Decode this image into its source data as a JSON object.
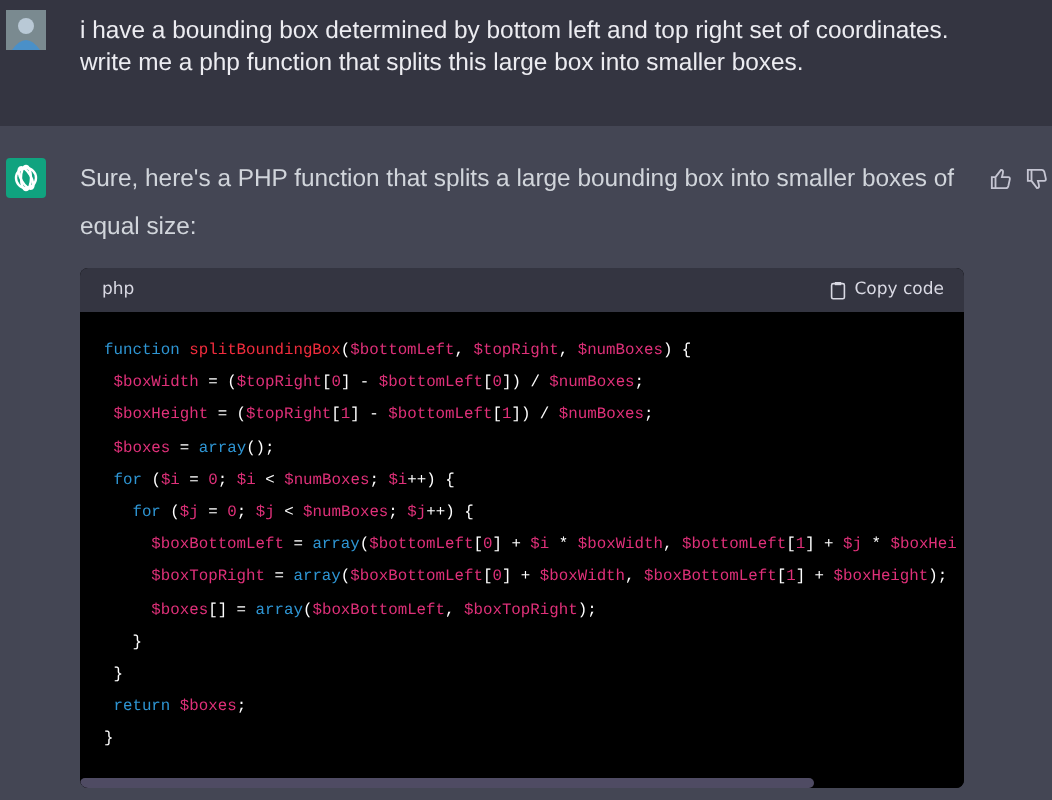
{
  "user_message": {
    "text": "i have a bounding box determined by bottom left and top right set of coordinates. write me a php function that splits this large box into smaller boxes."
  },
  "assistant_message": {
    "text": "Sure, here's a PHP function that splits a large bounding box into smaller boxes of equal size:",
    "code_block": {
      "language": "php",
      "copy_label": "Copy code",
      "lines": [
        [
          {
            "kind": "keyword",
            "text": "function "
          },
          {
            "kind": "name",
            "text": "splitBoundingBox"
          },
          {
            "kind": "plain",
            "text": "("
          },
          {
            "kind": "variable",
            "text": "$bottomLeft"
          },
          {
            "kind": "plain",
            "text": ", "
          },
          {
            "kind": "variable",
            "text": "$topRight"
          },
          {
            "kind": "plain",
            "text": ", "
          },
          {
            "kind": "variable",
            "text": "$numBoxes"
          },
          {
            "kind": "plain",
            "text": ") {"
          }
        ],
        [
          {
            "kind": "variable",
            "text": " $boxWidth"
          },
          {
            "kind": "plain",
            "text": " = ("
          },
          {
            "kind": "variable",
            "text": "$topRight"
          },
          {
            "kind": "plain",
            "text": "["
          },
          {
            "kind": "number",
            "text": "0"
          },
          {
            "kind": "plain",
            "text": "] - "
          },
          {
            "kind": "variable",
            "text": "$bottomLeft"
          },
          {
            "kind": "plain",
            "text": "["
          },
          {
            "kind": "number",
            "text": "0"
          },
          {
            "kind": "plain",
            "text": "]) / "
          },
          {
            "kind": "variable",
            "text": "$numBoxes"
          },
          {
            "kind": "plain",
            "text": ";"
          }
        ],
        [
          {
            "kind": "variable",
            "text": " $boxHeight"
          },
          {
            "kind": "plain",
            "text": " = ("
          },
          {
            "kind": "variable",
            "text": "$topRight"
          },
          {
            "kind": "plain",
            "text": "["
          },
          {
            "kind": "number",
            "text": "1"
          },
          {
            "kind": "plain",
            "text": "] - "
          },
          {
            "kind": "variable",
            "text": "$bottomLeft"
          },
          {
            "kind": "plain",
            "text": "["
          },
          {
            "kind": "number",
            "text": "1"
          },
          {
            "kind": "plain",
            "text": "]) / "
          },
          {
            "kind": "variable",
            "text": "$numBoxes"
          },
          {
            "kind": "plain",
            "text": ";"
          }
        ],
        [
          {
            "kind": "variable",
            "text": " $boxes"
          },
          {
            "kind": "plain",
            "text": " = "
          },
          {
            "kind": "keyword",
            "text": "array"
          },
          {
            "kind": "plain",
            "text": "();"
          }
        ],
        [
          {
            "kind": "keyword",
            "text": " for"
          },
          {
            "kind": "plain",
            "text": " ("
          },
          {
            "kind": "variable",
            "text": "$i"
          },
          {
            "kind": "plain",
            "text": " = "
          },
          {
            "kind": "number",
            "text": "0"
          },
          {
            "kind": "plain",
            "text": "; "
          },
          {
            "kind": "variable",
            "text": "$i"
          },
          {
            "kind": "plain",
            "text": " < "
          },
          {
            "kind": "variable",
            "text": "$numBoxes"
          },
          {
            "kind": "plain",
            "text": "; "
          },
          {
            "kind": "variable",
            "text": "$i"
          },
          {
            "kind": "plain",
            "text": "++) {"
          }
        ],
        [
          {
            "kind": "keyword",
            "text": "   for"
          },
          {
            "kind": "plain",
            "text": " ("
          },
          {
            "kind": "variable",
            "text": "$j"
          },
          {
            "kind": "plain",
            "text": " = "
          },
          {
            "kind": "number",
            "text": "0"
          },
          {
            "kind": "plain",
            "text": "; "
          },
          {
            "kind": "variable",
            "text": "$j"
          },
          {
            "kind": "plain",
            "text": " < "
          },
          {
            "kind": "variable",
            "text": "$numBoxes"
          },
          {
            "kind": "plain",
            "text": "; "
          },
          {
            "kind": "variable",
            "text": "$j"
          },
          {
            "kind": "plain",
            "text": "++) {"
          }
        ],
        [
          {
            "kind": "variable",
            "text": "     $boxBottomLeft"
          },
          {
            "kind": "plain",
            "text": " = "
          },
          {
            "kind": "keyword",
            "text": "array"
          },
          {
            "kind": "plain",
            "text": "("
          },
          {
            "kind": "variable",
            "text": "$bottomLeft"
          },
          {
            "kind": "plain",
            "text": "["
          },
          {
            "kind": "number",
            "text": "0"
          },
          {
            "kind": "plain",
            "text": "] + "
          },
          {
            "kind": "variable",
            "text": "$i"
          },
          {
            "kind": "plain",
            "text": " * "
          },
          {
            "kind": "variable",
            "text": "$boxWidth"
          },
          {
            "kind": "plain",
            "text": ", "
          },
          {
            "kind": "variable",
            "text": "$bottomLeft"
          },
          {
            "kind": "plain",
            "text": "["
          },
          {
            "kind": "number",
            "text": "1"
          },
          {
            "kind": "plain",
            "text": "] + "
          },
          {
            "kind": "variable",
            "text": "$j"
          },
          {
            "kind": "plain",
            "text": " * "
          },
          {
            "kind": "variable",
            "text": "$boxHei"
          }
        ],
        [
          {
            "kind": "variable",
            "text": "     $boxTopRight"
          },
          {
            "kind": "plain",
            "text": " = "
          },
          {
            "kind": "keyword",
            "text": "array"
          },
          {
            "kind": "plain",
            "text": "("
          },
          {
            "kind": "variable",
            "text": "$boxBottomLeft"
          },
          {
            "kind": "plain",
            "text": "["
          },
          {
            "kind": "number",
            "text": "0"
          },
          {
            "kind": "plain",
            "text": "] + "
          },
          {
            "kind": "variable",
            "text": "$boxWidth"
          },
          {
            "kind": "plain",
            "text": ", "
          },
          {
            "kind": "variable",
            "text": "$boxBottomLeft"
          },
          {
            "kind": "plain",
            "text": "["
          },
          {
            "kind": "number",
            "text": "1"
          },
          {
            "kind": "plain",
            "text": "] + "
          },
          {
            "kind": "variable",
            "text": "$boxHeight"
          },
          {
            "kind": "plain",
            "text": ");"
          }
        ],
        [
          {
            "kind": "variable",
            "text": "     $boxes"
          },
          {
            "kind": "plain",
            "text": "[] = "
          },
          {
            "kind": "keyword",
            "text": "array"
          },
          {
            "kind": "plain",
            "text": "("
          },
          {
            "kind": "variable",
            "text": "$boxBottomLeft"
          },
          {
            "kind": "plain",
            "text": ", "
          },
          {
            "kind": "variable",
            "text": "$boxTopRight"
          },
          {
            "kind": "plain",
            "text": ");"
          }
        ],
        [
          {
            "kind": "plain",
            "text": "   }"
          }
        ],
        [
          {
            "kind": "plain",
            "text": " }"
          }
        ],
        [
          {
            "kind": "keyword",
            "text": " return "
          },
          {
            "kind": "variable",
            "text": "$boxes"
          },
          {
            "kind": "plain",
            "text": ";"
          }
        ],
        [
          {
            "kind": "plain",
            "text": "}"
          }
        ]
      ]
    }
  }
}
